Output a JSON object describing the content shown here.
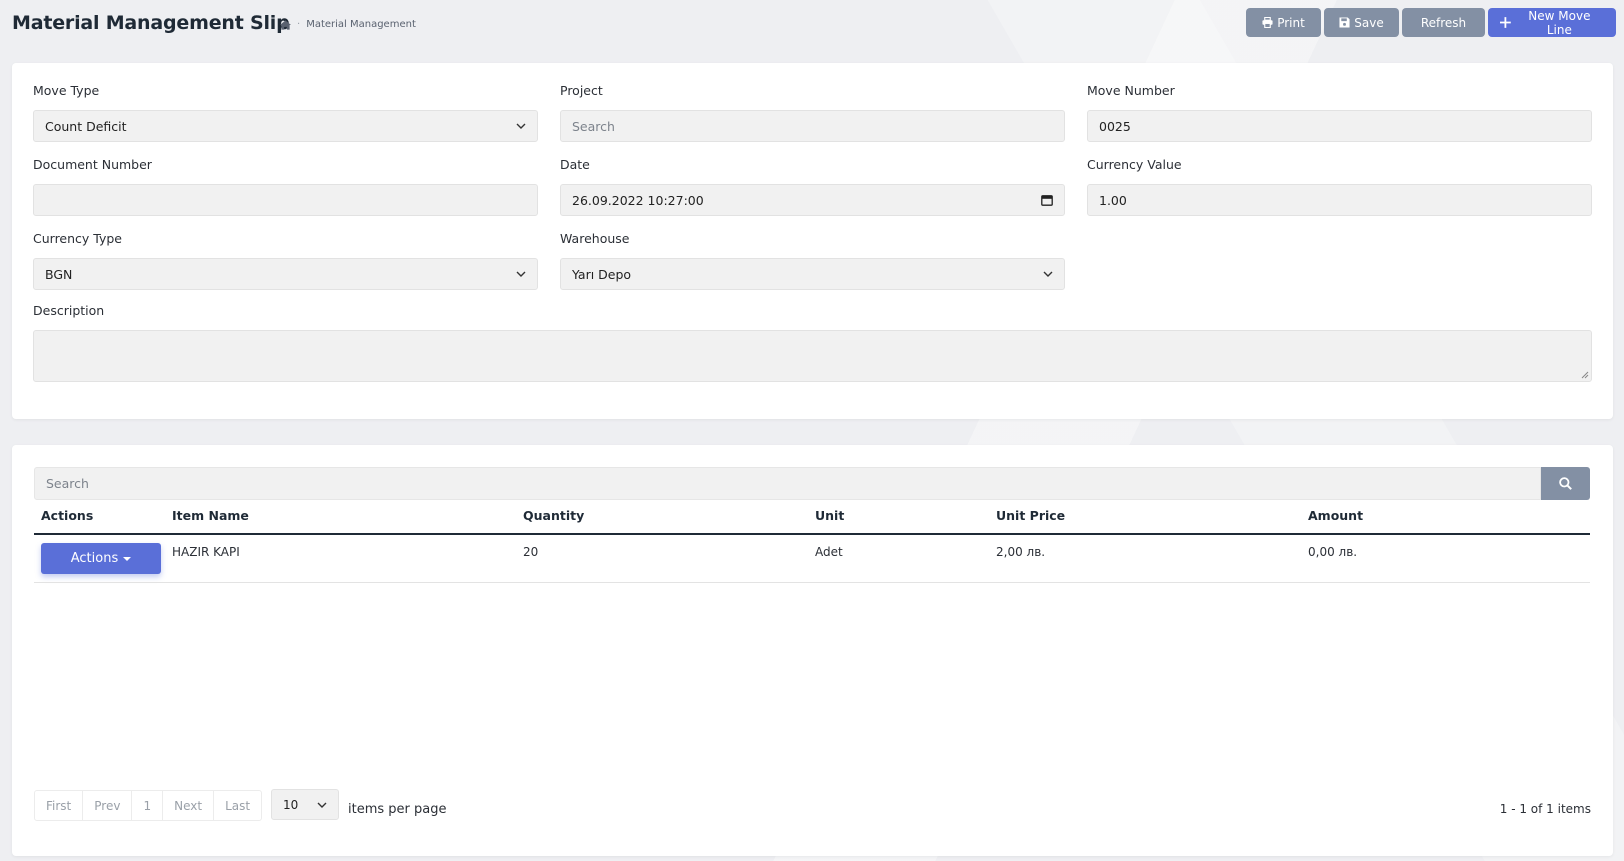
{
  "header": {
    "title": "Material Management Slip",
    "breadcrumb": "Material Management"
  },
  "toolbar": {
    "print_label": "Print",
    "save_label": "Save",
    "refresh_label": "Refresh",
    "new_label": "New Move Line"
  },
  "form": {
    "move_type": {
      "label": "Move Type",
      "value": "Count Deficit"
    },
    "project": {
      "label": "Project",
      "placeholder": "Search"
    },
    "move_number": {
      "label": "Move Number",
      "value": "0025"
    },
    "document_number": {
      "label": "Document Number",
      "value": ""
    },
    "date": {
      "label": "Date",
      "value": "26.09.2022 10:27:00"
    },
    "currency_value": {
      "label": "Currency Value",
      "value": "1.00"
    },
    "currency_type": {
      "label": "Currency Type",
      "value": "BGN"
    },
    "warehouse": {
      "label": "Warehouse",
      "value": "Yarı Depo"
    },
    "description": {
      "label": "Description",
      "value": ""
    }
  },
  "list": {
    "search_placeholder": "Search",
    "columns": [
      "Actions",
      "Item Name",
      "Quantity",
      "Unit",
      "Unit Price",
      "Amount"
    ],
    "rows": [
      {
        "action_label": "Actions",
        "item_name": "HAZIR KAPI",
        "quantity": "20",
        "unit": "Adet",
        "unit_price": "2,00 лв.",
        "amount": "0,00 лв."
      }
    ],
    "pager": {
      "first": "First",
      "prev": "Prev",
      "page": "1",
      "next": "Next",
      "last": "Last",
      "per_page": "10",
      "per_page_label": "items per page",
      "count": "1 - 1 of 1 items"
    }
  },
  "colors": {
    "primary": "#5a6fd8",
    "secondary": "#8390a4"
  }
}
